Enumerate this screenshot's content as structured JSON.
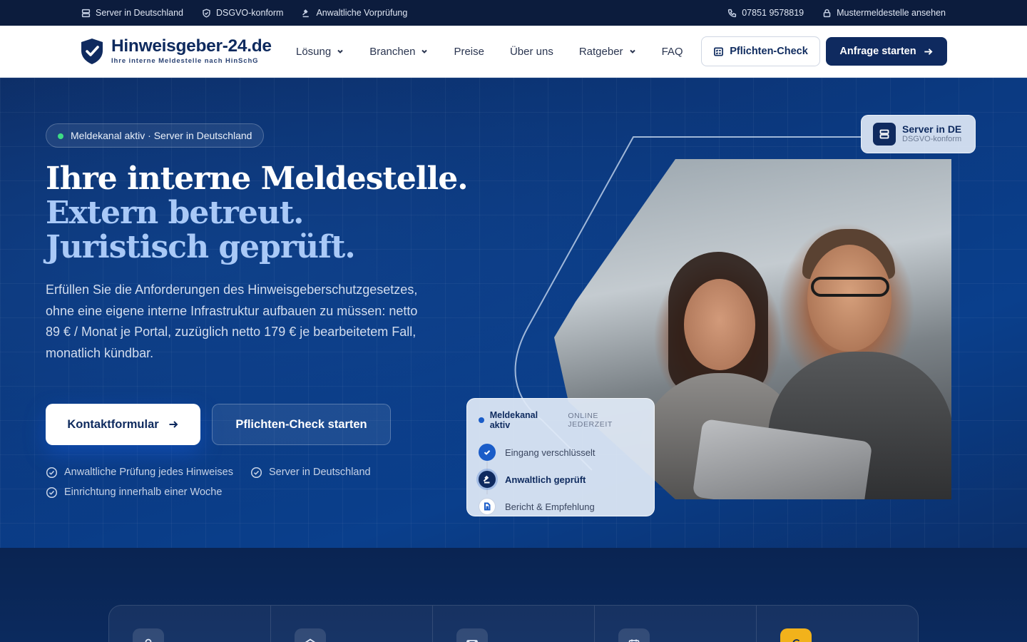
{
  "topbar": {
    "left": [
      {
        "icon": "server-icon",
        "label": "Server in Deutschland"
      },
      {
        "icon": "shield-check-icon",
        "label": "DSGVO-konform"
      },
      {
        "icon": "gavel-icon",
        "label": "Anwaltliche Vorprüfung"
      }
    ],
    "right": [
      {
        "icon": "phone-icon",
        "label": "07851 9578819"
      },
      {
        "icon": "lock-icon",
        "label": "Mustermeldestelle ansehen"
      }
    ]
  },
  "nav": {
    "logo_name": "Hinweisgeber-24.de",
    "logo_tagline": "Ihre interne Meldestelle nach HinSchG",
    "menu": [
      {
        "label": "Lösung",
        "dropdown": true
      },
      {
        "label": "Branchen",
        "dropdown": true
      },
      {
        "label": "Preise",
        "dropdown": false
      },
      {
        "label": "Über uns",
        "dropdown": false
      },
      {
        "label": "Ratgeber",
        "dropdown": true
      },
      {
        "label": "FAQ",
        "dropdown": false
      }
    ],
    "check_button": "Pflichten-Check",
    "cta_button": "Anfrage starten"
  },
  "hero": {
    "badge": "Meldekanal aktiv · Server in Deutschland",
    "headline_1": "Ihre interne Meldestelle.",
    "headline_2": "Extern betreut. Juristisch geprüft.",
    "lead": "Erfüllen Sie die Anforderungen des Hinweisgeberschutzgesetzes, ohne eine eigene interne Infrastruktur aufbauen zu müssen: netto 89 € / Monat je Portal, zuzüglich netto 179 € je bearbeitetem Fall, monatlich kündbar.",
    "cta_primary": "Kontaktformular",
    "cta_secondary": "Pflichten-Check starten",
    "checks": [
      "Anwaltliche Prüfung jedes Hinweises",
      "Server in Deutschland",
      "Einrichtung innerhalb einer Woche"
    ]
  },
  "server_card": {
    "title": "Server in DE",
    "subtitle": "DSGVO-konform"
  },
  "status_card": {
    "title": "Meldekanal aktiv",
    "subtitle": "ONLINE JEDERZEIT",
    "steps": [
      {
        "label": "Eingang verschlüsselt",
        "state": "done"
      },
      {
        "label": "Anwaltlich geprüft",
        "state": "active"
      },
      {
        "label": "Bericht & Empfehlung",
        "state": "todo"
      }
    ]
  },
  "stats_icons": [
    "person-icon",
    "bank-icon",
    "mail-icon",
    "calendar-icon",
    "euro-icon"
  ],
  "colors": {
    "navy": "#0f2a5f",
    "accent_light": "#a9c9f7",
    "status_green": "#3ddc84",
    "gold": "#f2b21b"
  }
}
